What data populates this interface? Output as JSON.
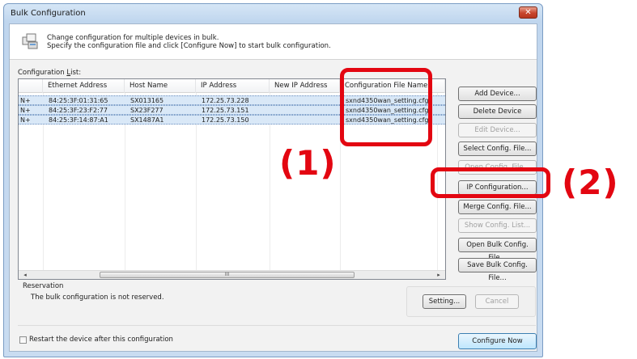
{
  "window": {
    "title": "Bulk Configuration",
    "close_glyph": "✕"
  },
  "header": {
    "line1": "Change configuration for multiple devices in bulk.",
    "line2": "Specify the configuration file and click [Configure Now] to start bulk configuration.",
    "icon": "devices-icon"
  },
  "list": {
    "label_pre": "Configuration ",
    "label_u": "L",
    "label_post": "ist:",
    "columns": [
      "",
      "Ethernet Address",
      "Host Name",
      "IP Address",
      "New IP Address",
      "Configuration File Name"
    ],
    "rows": [
      {
        "status": "N+",
        "mac": "84:25:3F:01:31:65",
        "host": "SX013165",
        "ip": "172.25.73.228",
        "new_ip": "",
        "file": "sxnd4350wan_setting.cfg"
      },
      {
        "status": "N+",
        "mac": "84:25:3F:23:F2:77",
        "host": "SX23F277",
        "ip": "172.25.73.151",
        "new_ip": "",
        "file": "sxnd4350wan_setting.cfg"
      },
      {
        "status": "N+",
        "mac": "84:25:3F:14:87:A1",
        "host": "SX1487A1",
        "ip": "172.25.73.150",
        "new_ip": "",
        "file": "sxnd4350wan_setting.cfg"
      }
    ],
    "scroll_left": "◂",
    "scroll_right": "▸",
    "scroll_thumb": "III"
  },
  "buttons": {
    "add_device": "Add Device...",
    "delete_device": "Delete Device",
    "edit_device": "Edit Device...",
    "select_config_file": "Select Config. File...",
    "open_config_file": "Open Config. File...",
    "ip_configuration": "IP Configuration...",
    "merge_config_file": "Merge Config. File...",
    "show_config_list": "Show Config. List...",
    "open_bulk_config_file": "Open Bulk Config. File...",
    "save_bulk_config_file": "Save Bulk Config. File...",
    "setting": "Setting...",
    "cancel": "Cancel",
    "configure_now": "Configure Now"
  },
  "reservation": {
    "title": "Reservation",
    "status": "The bulk configuration is not reserved."
  },
  "restart_label": "Restart the device after this configuration",
  "annotations": {
    "label1": "(1)",
    "label2": "(2)",
    "color": "#e30611"
  }
}
